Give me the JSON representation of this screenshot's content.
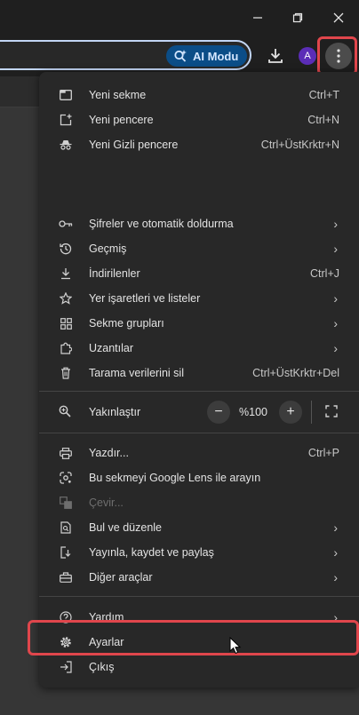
{
  "window": {
    "minimize_icon": "minimize-icon",
    "restore_icon": "restore-icon",
    "close_icon": "close-icon"
  },
  "toolbar": {
    "ai_mode_label": "AI Modu",
    "avatar_letter": "A",
    "accent_color": "#0b4d87",
    "highlight_color": "#e0464c"
  },
  "menu": {
    "new_tab": {
      "label": "Yeni sekme",
      "shortcut": "Ctrl+T"
    },
    "new_window": {
      "label": "Yeni pencere",
      "shortcut": "Ctrl+N"
    },
    "new_incognito": {
      "label": "Yeni Gizli pencere",
      "shortcut": "Ctrl+ÜstKrktr+N"
    },
    "passwords": {
      "label": "Şifreler ve otomatik doldurma"
    },
    "history": {
      "label": "Geçmiş"
    },
    "downloads": {
      "label": "İndirilenler",
      "shortcut": "Ctrl+J"
    },
    "bookmarks": {
      "label": "Yer işaretleri ve listeler"
    },
    "tab_groups": {
      "label": "Sekme grupları"
    },
    "extensions": {
      "label": "Uzantılar"
    },
    "clear_data": {
      "label": "Tarama verilerini sil",
      "shortcut": "Ctrl+ÜstKrktr+Del"
    },
    "zoom": {
      "label": "Yakınlaştır",
      "value": "%100",
      "minus": "−",
      "plus": "+"
    },
    "print": {
      "label": "Yazdır...",
      "shortcut": "Ctrl+P"
    },
    "lens": {
      "label": "Bu sekmeyi Google Lens ile arayın"
    },
    "translate": {
      "label": "Çevir..."
    },
    "find_edit": {
      "label": "Bul ve düzenle"
    },
    "cast_save_share": {
      "label": "Yayınla, kaydet ve paylaş"
    },
    "more_tools": {
      "label": "Diğer araçlar"
    },
    "help": {
      "label": "Yardım"
    },
    "settings": {
      "label": "Ayarlar"
    },
    "exit": {
      "label": "Çıkış"
    }
  }
}
